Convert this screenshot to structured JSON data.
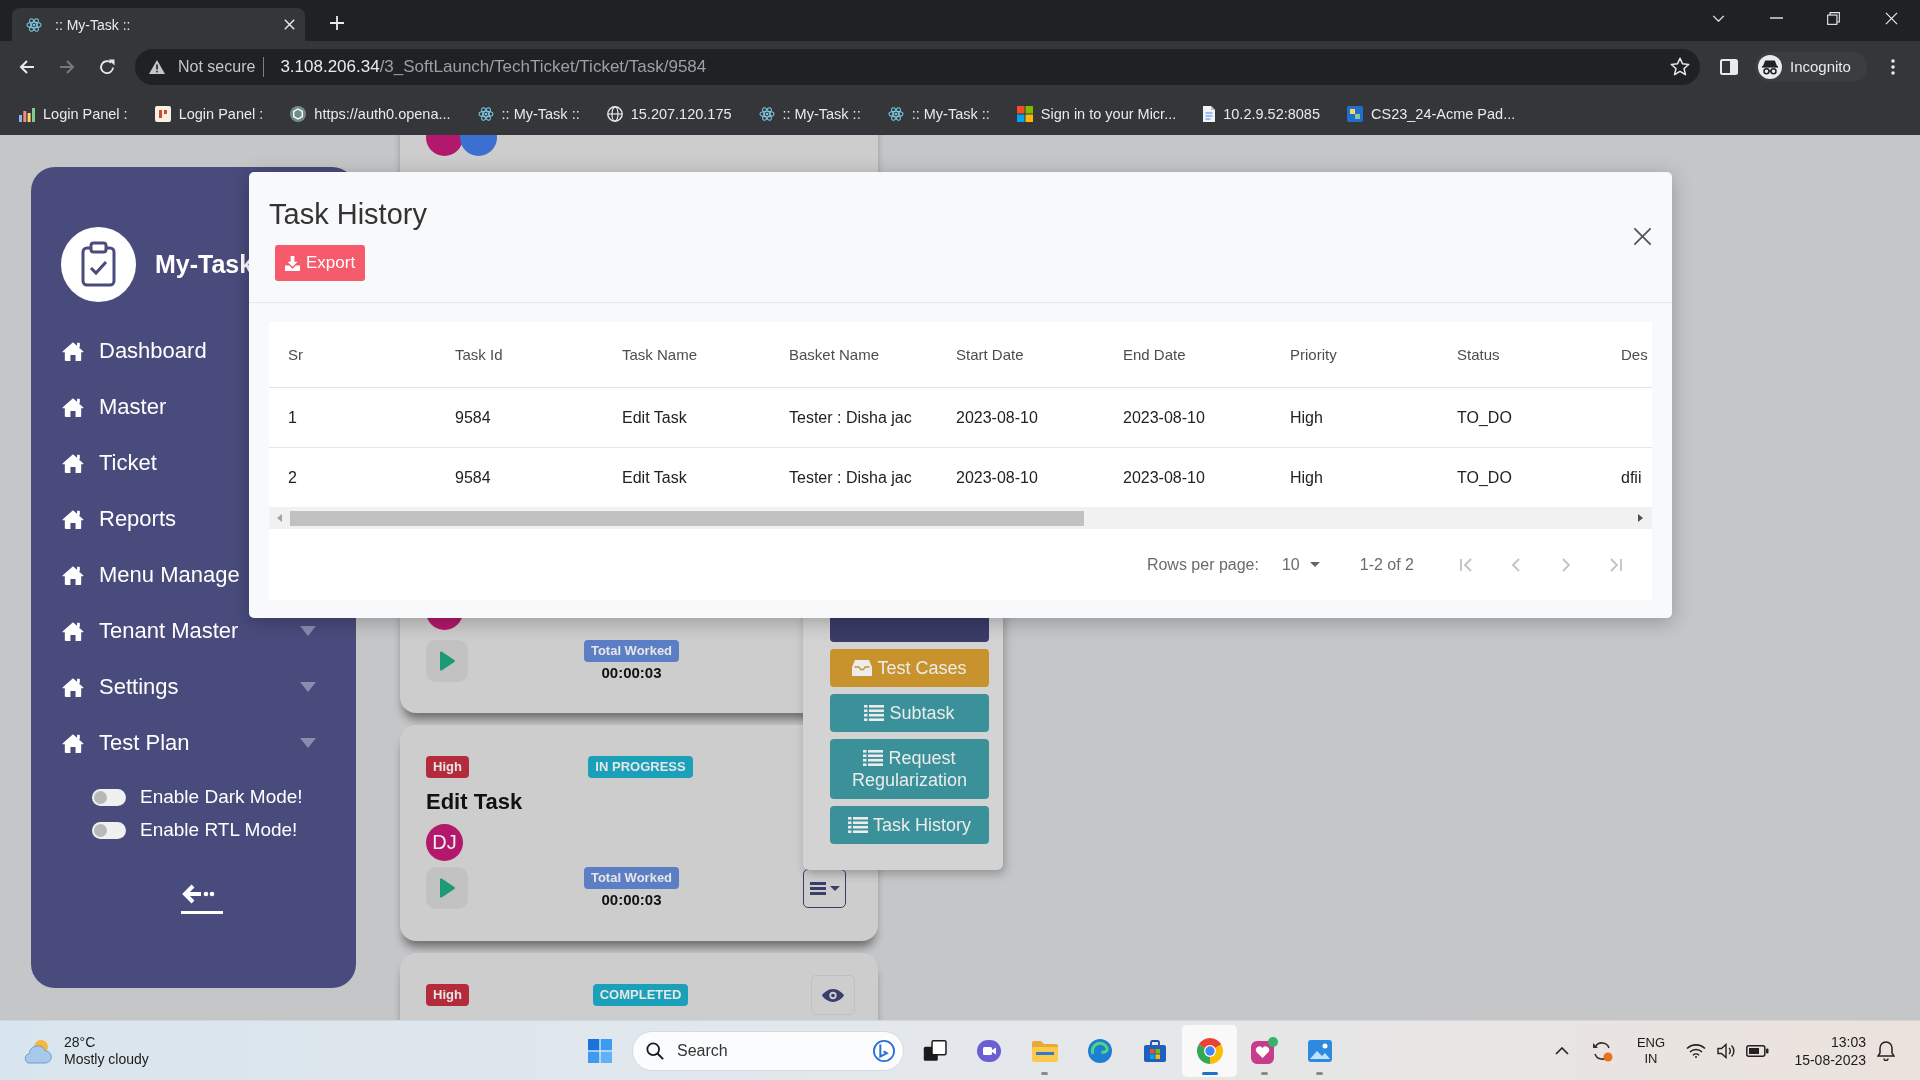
{
  "browser": {
    "tabs": [
      {
        "title": ":: My-Task ::",
        "selected": true
      }
    ],
    "nav": [
      {
        "kind": "back",
        "disabled": false
      },
      {
        "kind": "forward",
        "disabled": true
      },
      {
        "kind": "reload",
        "disabled": false
      }
    ],
    "address": {
      "security": "Not secure",
      "host": "3.108.206.34",
      "path": "/3_SoftLaunch/TechTicket/Ticket/Task/9584"
    },
    "profile": "Incognito",
    "bookmarks": [
      {
        "kind": "chart",
        "label": "Login Panel :"
      },
      {
        "kind": "logo",
        "label": "Login Panel :"
      },
      {
        "kind": "knot",
        "label": "https://auth0.opena..."
      },
      {
        "kind": "atom",
        "label": ":: My-Task ::"
      },
      {
        "kind": "globe",
        "label": "15.207.120.175"
      },
      {
        "kind": "atom",
        "label": ":: My-Task ::"
      },
      {
        "kind": "atom",
        "label": ":: My-Task ::"
      },
      {
        "kind": "squares",
        "label": "Sign in to your Micr..."
      },
      {
        "kind": "document",
        "label": "10.2.9.52:8085"
      },
      {
        "kind": "app",
        "label": "CS23_24-Acme Pad..."
      }
    ]
  },
  "sidebar": {
    "brand": "My-Task",
    "items": [
      {
        "label": "Dashboard",
        "expandable": false,
        "selected": false
      },
      {
        "label": "Master",
        "expandable": false,
        "selected": false
      },
      {
        "label": "Ticket",
        "expandable": false,
        "selected": false
      },
      {
        "label": "Reports",
        "expandable": false,
        "selected": false
      },
      {
        "label": "Menu Manage",
        "expandable": false,
        "selected": false
      },
      {
        "label": "Tenant Master",
        "expandable": true,
        "selected": false
      },
      {
        "label": "Settings",
        "expandable": true,
        "selected": false
      },
      {
        "label": "Test Plan",
        "expandable": true,
        "selected": false
      }
    ],
    "toggles": [
      {
        "label": "Enable Dark Mode!",
        "on": false
      },
      {
        "label": "Enable RTL Mode!",
        "on": false
      }
    ]
  },
  "task_cards": [
    {
      "avatars": [
        {
          "color": "#b3186c"
        },
        {
          "color": "#3d6fd1"
        }
      ]
    },
    {
      "avatars": [
        {
          "color": "#b3186c"
        }
      ],
      "worked_label": "Total Worked",
      "worked_time": "00:00:03"
    },
    {
      "priority": "High",
      "status": "IN PROGRESS",
      "title": "Edit Task",
      "avatars": [
        {
          "initials": "DJ",
          "color": "#b3186c"
        }
      ],
      "worked_label": "Total Worked",
      "worked_time": "00:00:03",
      "action": {
        "kind": "menu"
      }
    },
    {
      "priority": "High",
      "status": "COMPLETED",
      "action": {
        "kind": "view"
      }
    }
  ],
  "task_menu": {
    "items": [
      {
        "color": "#3a3c69"
      },
      {
        "kind": "tray",
        "label": "Test Cases",
        "color": "#c8922c"
      },
      {
        "kind": "list",
        "label": "Subtask",
        "color": "#3b9199"
      },
      {
        "kind": "list",
        "label": "Request Regularization",
        "color": "#3b9199"
      },
      {
        "kind": "list",
        "label": "Task History",
        "color": "#3b9199"
      }
    ]
  },
  "modal": {
    "title": "Task History",
    "export_label": "Export",
    "table": {
      "columns": [
        "Sr",
        "Task Id",
        "Task Name",
        "Basket Name",
        "Start Date",
        "End Date",
        "Priority",
        "Status",
        "Des"
      ],
      "rows": [
        [
          "1",
          "9584",
          "Edit Task",
          "Tester : Disha jac",
          "2023-08-10",
          "2023-08-10",
          "High",
          "TO_DO"
        ],
        [
          "2",
          "9584",
          "Edit Task",
          "Tester : Disha jac",
          "2023-08-10",
          "2023-08-10",
          "High",
          "TO_DO",
          "dfii"
        ]
      ]
    },
    "pagination": {
      "rows_per_page_label": "Rows per page:",
      "rows_per_page": "10",
      "range": "1-2 of 2",
      "buttons": [
        {
          "kind": "first",
          "disabled": true
        },
        {
          "kind": "prev",
          "disabled": true
        },
        {
          "kind": "next",
          "disabled": true
        },
        {
          "kind": "last",
          "disabled": true
        }
      ]
    }
  },
  "taskbar": {
    "weather": {
      "temperature": "28°C",
      "condition": "Mostly cloudy"
    },
    "search_placeholder": "Search",
    "apps": [
      {
        "kind": "task-view",
        "running": false,
        "selected": false
      },
      {
        "kind": "video",
        "running": false,
        "selected": false
      },
      {
        "kind": "folder",
        "running": true,
        "selected": false
      },
      {
        "kind": "swirl",
        "running": false,
        "selected": false
      },
      {
        "kind": "store",
        "running": false,
        "selected": false
      },
      {
        "kind": "browser",
        "running": true,
        "selected": true
      },
      {
        "kind": "app-tile",
        "running": true,
        "selected": false
      },
      {
        "kind": "photos",
        "running": true,
        "selected": false
      }
    ],
    "tray": {
      "language": "ENG",
      "region": "IN",
      "time": "13:03",
      "date": "15-08-2023"
    }
  }
}
